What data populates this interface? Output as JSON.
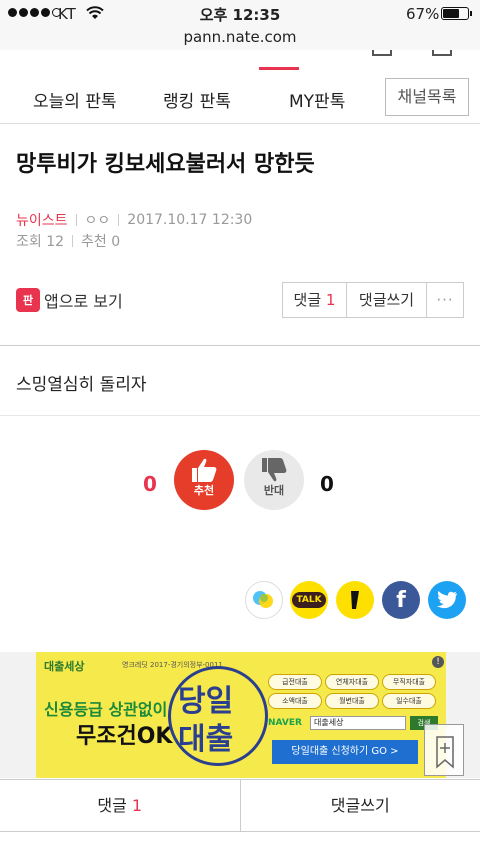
{
  "status_bar": {
    "carrier": "KT",
    "time": "오후 12:35",
    "battery": "67%",
    "battery_level": 0.67
  },
  "browser": {
    "url": "pann.nate.com"
  },
  "nav": {
    "tabs": [
      "오늘의 판톡",
      "랭킹 판톡",
      "MY판톡"
    ],
    "channel_button": "채널목록"
  },
  "article": {
    "title": "망투비가 킹보세요불러서 망한듯",
    "category": "뉴이스트",
    "author": "ㅇㅇ",
    "date": "2017.10.17 12:30",
    "views": "조회 12",
    "recommends": "추천 0",
    "body": "스밍열심히 돌리자"
  },
  "actions": {
    "app_icon_text": "판",
    "app_view": "앱으로 보기",
    "comment_label": "댓글",
    "comment_count": "1",
    "write_comment": "댓글쓰기",
    "more": "···"
  },
  "votes": {
    "up_count": "0",
    "up_label": "추천",
    "down_label": "반대",
    "down_count": "0"
  },
  "share": {
    "kakaostory_icon": "kakaostory-icon",
    "kakaotalk_label": "TALK",
    "kakao_icon": "kakao-icon",
    "facebook_label": "f",
    "twitter_icon": "twitter-icon"
  },
  "ad": {
    "logo": "대출세상",
    "fine_print": "영크레딧 2017-경기의정부-0011",
    "line1": "신용등급 상관없이",
    "line2": "무조건OK",
    "big1": "당일",
    "big2": "대출",
    "chips": [
      "급전대출",
      "연체자대출",
      "무직자대출",
      "소액대출",
      "월변대출",
      "일수대출"
    ],
    "naver_label": "NAVER",
    "search_value": "대출세상",
    "search_button": "검색",
    "cta": "당일대출 신청하기 GO >",
    "info": "!"
  },
  "bottom_bar": {
    "comment_label": "댓글",
    "comment_count": "1",
    "write_comment": "댓글쓰기"
  },
  "colors": {
    "accent": "#e8344e",
    "like": "#e63c2a",
    "facebook": "#3b5998",
    "twitter": "#1da1f2",
    "kakao": "#fde000"
  }
}
